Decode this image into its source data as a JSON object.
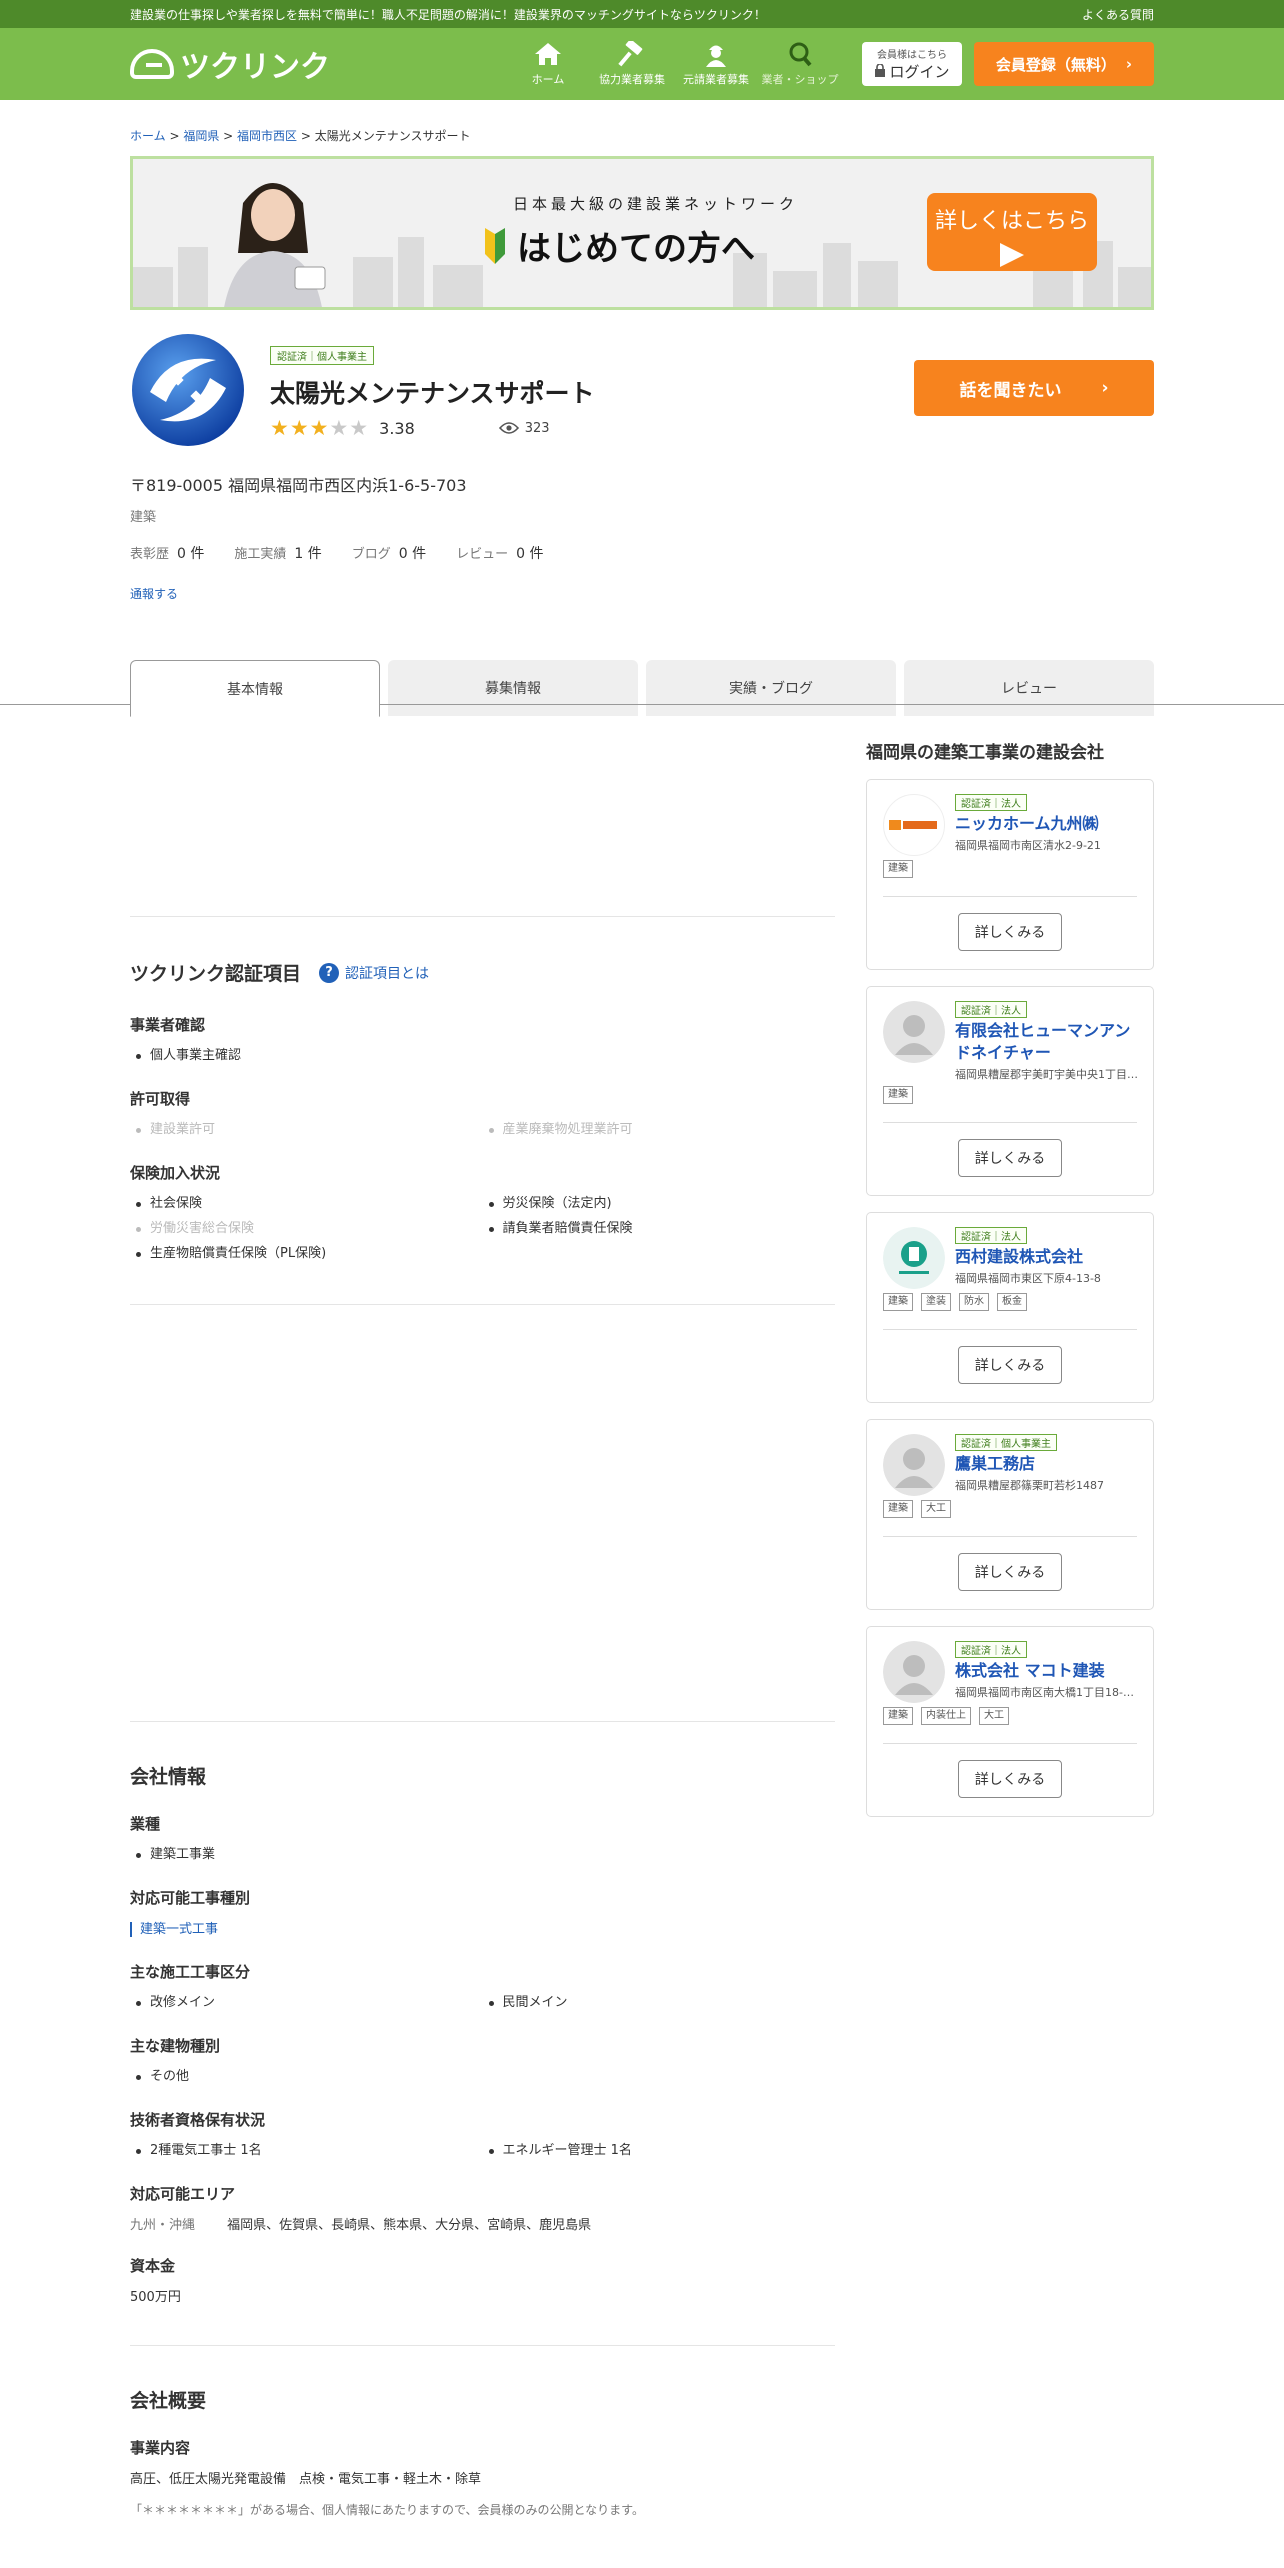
{
  "topbar": {
    "tagline": "建設業の仕事探しや業者探しを無料で簡単に！職人不足問題の解消に！建設業界のマッチングサイトならツクリンク！",
    "faq": "よくある質問"
  },
  "header": {
    "logo_text": "ツクリンク",
    "nav": [
      {
        "label": "ホーム",
        "icon": "home-icon"
      },
      {
        "label": "協力業者募集",
        "icon": "hammer-icon"
      },
      {
        "label": "元請業者募集",
        "icon": "worker-icon"
      },
      {
        "label": "業者・ショップ",
        "icon": "search-icon"
      }
    ],
    "login_sub": "会員様はこちら",
    "login_label": "ログイン",
    "register_label": "会員登録（無料）"
  },
  "breadcrumb": [
    "ホーム",
    "福岡県",
    "福岡市西区",
    "太陽光メンテナンスサポート"
  ],
  "banner": {
    "subtitle": "日本最大級の建設業ネットワーク",
    "title": "はじめての方へ",
    "button": "詳しくはこちら"
  },
  "company": {
    "cert": "認証済｜個人事業主",
    "name": "太陽光メンテナンスサポート",
    "rating": 3.38,
    "rating_label": "3.38",
    "views": "323",
    "cta": "話を聞きたい",
    "address": "〒819-0005 福岡県福岡市西区内浜1-6-5-703",
    "category": "建築",
    "counts": [
      {
        "label": "表彰歴",
        "value": "0 件"
      },
      {
        "label": "施工実績",
        "value": "1 件"
      },
      {
        "label": "ブログ",
        "value": "0 件"
      },
      {
        "label": "レビュー",
        "value": "0 件"
      }
    ],
    "report": "通報する"
  },
  "tabs": [
    "基本情報",
    "募集情報",
    "実績・ブログ",
    "レビュー"
  ],
  "certification": {
    "title": "ツクリンク認証項目",
    "help": "認証項目とは",
    "business_title": "事業者確認",
    "business_items": [
      {
        "label": "個人事業主確認",
        "on": true
      }
    ],
    "permit_title": "許可取得",
    "permit_items": [
      {
        "label": "建設業許可",
        "on": false
      },
      {
        "label": "産業廃棄物処理業許可",
        "on": false
      }
    ],
    "insurance_title": "保険加入状況",
    "insurance_items": [
      {
        "label": "社会保険",
        "on": true
      },
      {
        "label": "労災保険（法定内)",
        "on": true
      },
      {
        "label": "労働災害総合保険",
        "on": false
      },
      {
        "label": "請負業者賠償責任保険",
        "on": true
      },
      {
        "label": "生産物賠償責任保険（PL保険)",
        "on": true
      }
    ]
  },
  "company_info": {
    "title": "会社情報",
    "industry_title": "業種",
    "industry": "建築工事業",
    "work_types_title": "対応可能工事種別",
    "work_type": "建築一式工事",
    "divisions_title": "主な施工工事区分",
    "divisions": [
      "改修メイン",
      "民間メイン"
    ],
    "buildings_title": "主な建物種別",
    "building": "その他",
    "licenses_title": "技術者資格保有状況",
    "licenses": [
      "2種電気工事士 1名",
      "エネルギー管理士 1名"
    ],
    "area_title": "対応可能エリア",
    "area_region": "九州・沖縄",
    "area_prefs": "福岡県、佐賀県、長崎県、熊本県、大分県、宮崎県、鹿児島県",
    "capital_title": "資本金",
    "capital": "500万円"
  },
  "overview": {
    "title": "会社概要",
    "business_title": "事業内容",
    "business": "高圧、低圧太陽光発電設備　点検・電気工事・軽土木・除草",
    "note": "「＊＊＊＊＊＊＊＊」がある場合、個人情報にあたりますので、会員様のみの公開となります。"
  },
  "sidebar": {
    "title": "福岡県の建築工事業の建設会社",
    "button": "詳しくみる",
    "cards": [
      {
        "cert": "認証済｜法人",
        "name": "ニッカホーム九州㈱",
        "addr": "福岡県福岡市南区清水2-9-21",
        "tags": [
          "建築"
        ],
        "avatar": "nikka-logo"
      },
      {
        "cert": "認証済｜法人",
        "name": "有限会社ヒューマンアンドネイチャー",
        "addr": "福岡県糟屋郡宇美町宇美中央1丁目…",
        "tags": [
          "建築"
        ],
        "avatar": "default-person"
      },
      {
        "cert": "認証済｜法人",
        "name": "西村建設株式会社",
        "addr": "福岡県福岡市東区下原4-13-8",
        "tags": [
          "建築",
          "塗装",
          "防水",
          "板金"
        ],
        "avatar": "nishimura-logo"
      },
      {
        "cert": "認証済｜個人事業主",
        "name": "鷹巣工務店",
        "addr": "福岡県糟屋郡篠栗町若杉1487",
        "tags": [
          "建築",
          "大工"
        ],
        "avatar": "default-person"
      },
      {
        "cert": "認証済｜法人",
        "name": "株式会社 マコト建装",
        "addr": "福岡県福岡市南区南大橋1丁目18-…",
        "tags": [
          "建築",
          "内装仕上",
          "大工"
        ],
        "avatar": "default-person"
      }
    ]
  },
  "colors": {
    "brand_green": "#7cbd4c",
    "dark_green": "#4e8a2a",
    "accent_orange": "#f7831e",
    "link_blue": "#2161b8"
  }
}
